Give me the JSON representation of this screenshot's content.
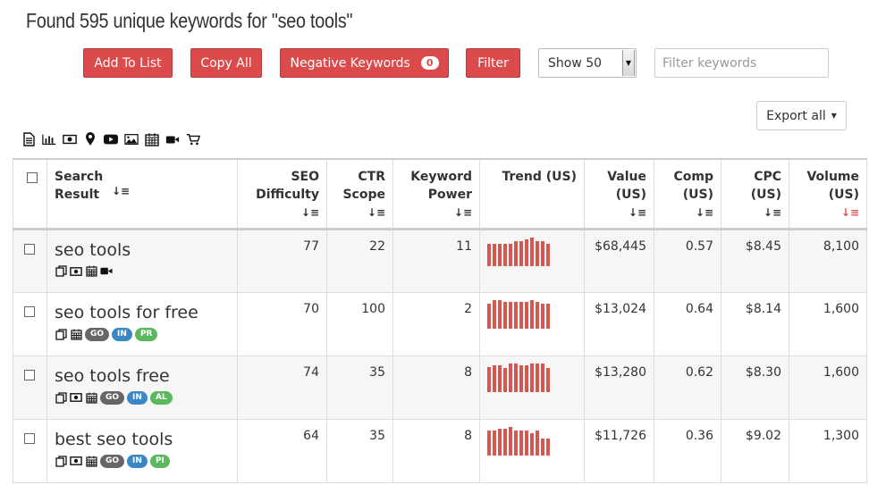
{
  "title": "Found 595 unique keywords for \"seo tools\"",
  "toolbar": {
    "add_to_list": "Add To List",
    "copy_all": "Copy All",
    "negative_keywords": "Negative Keywords",
    "negative_count": "0",
    "filter": "Filter",
    "show_select": "Show 50",
    "filter_placeholder": "Filter keywords",
    "export": "Export all"
  },
  "colors": {
    "accent": "#dc4b4b",
    "trend": "#d4584f",
    "pill_go": "#666666",
    "pill_in": "#3a87c8",
    "pill_pr": "#5cb85c"
  },
  "icon_bar": [
    "document-icon",
    "bar-chart-icon",
    "money-icon",
    "map-pin-icon",
    "youtube-icon",
    "image-icon",
    "calendar-icon",
    "video-camera-icon",
    "shopping-cart-icon"
  ],
  "columns": {
    "search_result": "Search Result",
    "seo_difficulty": "SEO Difficulty",
    "ctr_scope": "CTR Scope",
    "keyword_power": "Keyword Power",
    "trend": "Trend (US)",
    "value": "Value (US)",
    "comp": "Comp (US)",
    "cpc": "CPC (US)",
    "volume": "Volume (US)"
  },
  "rows": [
    {
      "keyword": "seo tools",
      "tags": [],
      "difficulty": "77",
      "ctr": "22",
      "power": "11",
      "value": "$68,445",
      "comp": "0.57",
      "cpc": "$8.45",
      "volume": "8,100",
      "trend": [
        0.78,
        0.78,
        0.78,
        0.78,
        0.78,
        0.89,
        0.89,
        0.95,
        1.0,
        0.86,
        0.86,
        0.78
      ]
    },
    {
      "keyword": "seo tools for free",
      "tags": [
        "GO",
        "IN",
        "PR"
      ],
      "difficulty": "70",
      "ctr": "100",
      "power": "2",
      "value": "$13,024",
      "comp": "0.64",
      "cpc": "$8.14",
      "volume": "1,600",
      "trend": [
        0.86,
        1.0,
        1.0,
        0.95,
        0.95,
        0.95,
        0.95,
        0.95,
        1.0,
        0.95,
        0.86,
        0.86
      ]
    },
    {
      "keyword": "seo tools free",
      "tags": [
        "GO",
        "IN",
        "AL"
      ],
      "difficulty": "74",
      "ctr": "35",
      "power": "8",
      "value": "$13,280",
      "comp": "0.62",
      "cpc": "$8.30",
      "volume": "1,600",
      "trend": [
        0.89,
        0.95,
        0.95,
        0.84,
        1.0,
        1.0,
        0.95,
        0.95,
        1.0,
        1.0,
        1.0,
        0.84
      ]
    },
    {
      "keyword": "best seo tools",
      "tags": [
        "GO",
        "IN",
        "PI"
      ],
      "difficulty": "64",
      "ctr": "35",
      "power": "8",
      "value": "$11,726",
      "comp": "0.36",
      "cpc": "$9.02",
      "volume": "1,300",
      "trend": [
        0.86,
        0.86,
        0.95,
        0.95,
        1.0,
        0.86,
        0.86,
        0.86,
        0.78,
        0.86,
        0.6,
        0.6
      ]
    }
  ]
}
